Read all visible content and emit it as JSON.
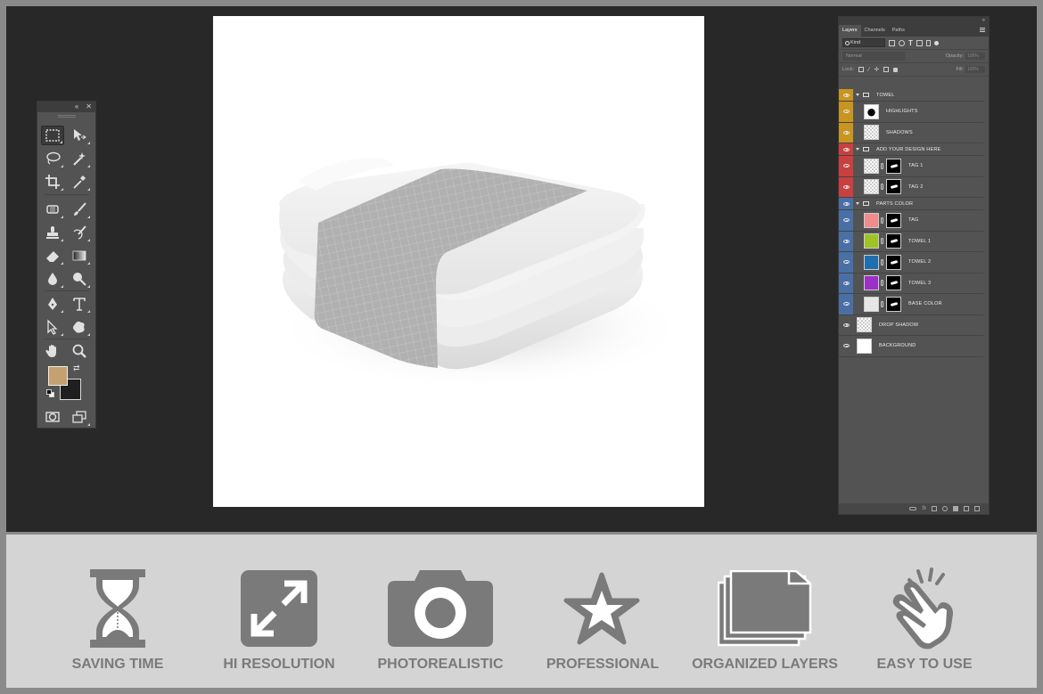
{
  "toolbox": {
    "collapse_icon": "double-chevron-left-icon",
    "close_icon": "close-icon",
    "tools": [
      "rectangular-marquee",
      "move",
      "lasso",
      "magic-wand",
      "crop",
      "eyedropper",
      "spot-healing-brush",
      "brush",
      "clone-stamp",
      "history-brush",
      "eraser",
      "gradient",
      "blur",
      "dodge",
      "pen",
      "type",
      "path-selection",
      "custom-shape",
      "hand",
      "zoom"
    ],
    "foreground_color": "#c6a170",
    "background_color": "#1f1f1f"
  },
  "layers_panel": {
    "tabs": [
      "Layers",
      "Channels",
      "Paths"
    ],
    "filter_label": "Kind",
    "blend_mode": "Normal",
    "opacity_label": "Opacity:",
    "opacity_value": "100%",
    "lock_label": "Lock:",
    "fill_label": "Fill:",
    "fill_value": "100%",
    "layers": [
      {
        "name": "TOWEL",
        "kind": "group",
        "color": "#c89520"
      },
      {
        "name": "HIGHLIGHTS",
        "kind": "layer",
        "color": "#c89520"
      },
      {
        "name": "SHADOWS",
        "kind": "layer",
        "color": "#c89520"
      },
      {
        "name": "ADD YOUR DESIGN HERE",
        "kind": "group",
        "color": "#c94040"
      },
      {
        "name": "TAG 1",
        "kind": "layer",
        "color": "#c94040"
      },
      {
        "name": "TAG 2",
        "kind": "layer",
        "color": "#c94040"
      },
      {
        "name": "PARTS COLOR",
        "kind": "group",
        "color": "#4a6fa5"
      },
      {
        "name": "TAG",
        "kind": "layer",
        "color": "#4a6fa5",
        "swatch": "#f08c8c"
      },
      {
        "name": "TOWEL 1",
        "kind": "layer",
        "color": "#4a6fa5",
        "swatch": "#9fc325"
      },
      {
        "name": "TOWEL 2",
        "kind": "layer",
        "color": "#4a6fa5",
        "swatch": "#1f6fb0"
      },
      {
        "name": "TOWEL 3",
        "kind": "layer",
        "color": "#4a6fa5",
        "swatch": "#9b30c8"
      },
      {
        "name": "BASE COLOR",
        "kind": "layer",
        "color": "#4a6fa5",
        "swatch": "#e6e6e6"
      },
      {
        "name": "DROP SHADOW",
        "kind": "layer",
        "color": "#535353"
      },
      {
        "name": "BACKGROUND",
        "kind": "layer",
        "color": "#535353"
      }
    ]
  },
  "features": [
    {
      "label": "SAVING TIME",
      "icon": "hourglass-icon"
    },
    {
      "label": "HI RESOLUTION",
      "icon": "expand-arrows-icon"
    },
    {
      "label": "PHOTOREALISTIC",
      "icon": "camera-icon"
    },
    {
      "label": "PROFESSIONAL",
      "icon": "star-icon"
    },
    {
      "label": "ORGANIZED LAYERS",
      "icon": "stacked-folders-icon"
    },
    {
      "label": "EASY TO USE",
      "icon": "tap-hand-icon"
    }
  ]
}
